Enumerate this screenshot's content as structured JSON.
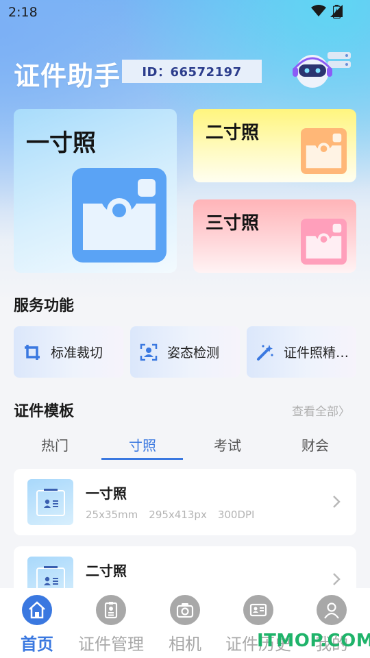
{
  "status_bar": {
    "time": "2:18"
  },
  "header": {
    "title": "证件助手",
    "id_label": "ID：66572197"
  },
  "photo_cards": [
    {
      "label": "一寸照",
      "color": "#5aa3f5"
    },
    {
      "label": "二寸照",
      "color": "#ffb777"
    },
    {
      "label": "三寸照",
      "color": "#ff9fbb"
    }
  ],
  "services": {
    "title": "服务功能",
    "items": [
      {
        "label": "标准裁切",
        "icon": "crop-icon"
      },
      {
        "label": "姿态检测",
        "icon": "portrait-scan-icon"
      },
      {
        "label": "证件照精…",
        "icon": "magic-wand-icon"
      }
    ]
  },
  "templates": {
    "title": "证件模板",
    "see_all": "查看全部〉",
    "tabs": [
      {
        "label": "热门"
      },
      {
        "label": "寸照",
        "active": true
      },
      {
        "label": "考试"
      },
      {
        "label": "财会"
      }
    ],
    "items": [
      {
        "name": "一寸照",
        "size_mm": "25x35mm",
        "size_px": "295x413px",
        "dpi": "300DPI"
      },
      {
        "name": "二寸照"
      }
    ]
  },
  "bottom_nav": {
    "items": [
      {
        "label": "首页",
        "icon": "home-icon",
        "active": true
      },
      {
        "label": "证件管理",
        "icon": "id-badge-icon"
      },
      {
        "label": "相机",
        "icon": "camera-icon"
      },
      {
        "label": "证件历史",
        "icon": "id-card-icon"
      },
      {
        "label": "我的",
        "icon": "profile-icon"
      }
    ]
  },
  "watermark": "ITMOP.COM",
  "colors": {
    "accent": "#3a78e0",
    "inactive": "#a8a8a8"
  }
}
